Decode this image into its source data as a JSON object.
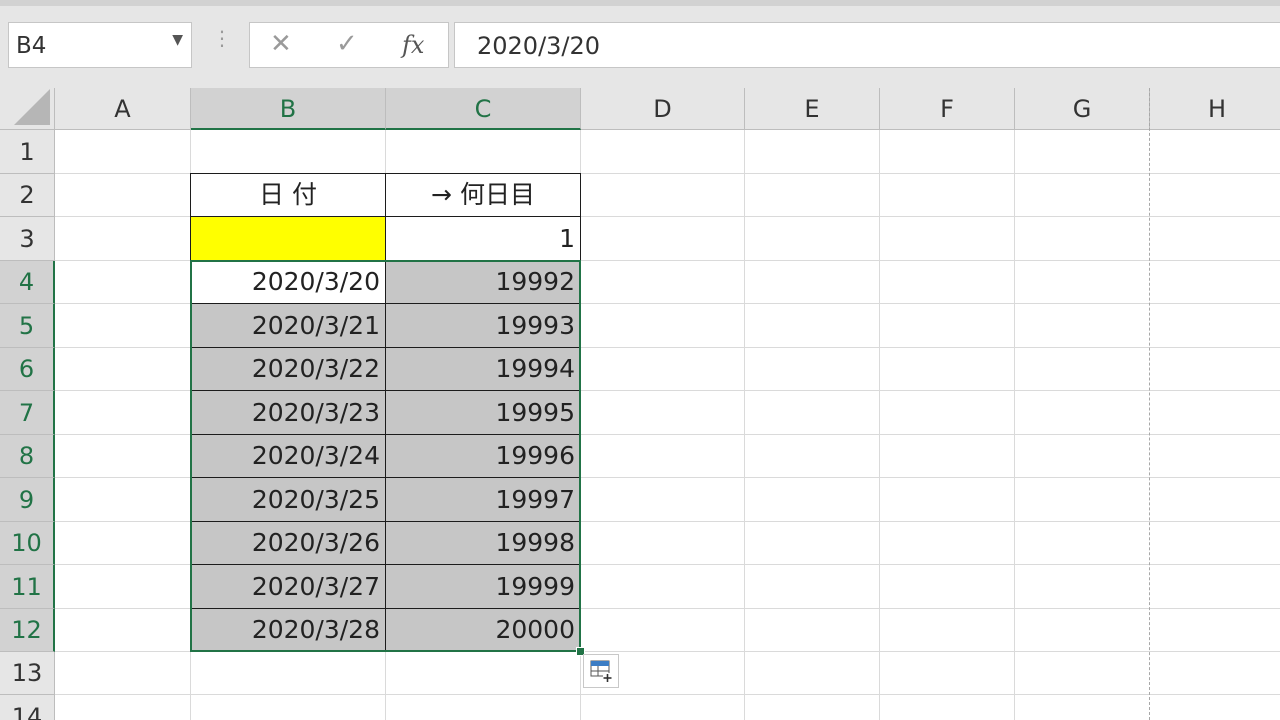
{
  "name_box": {
    "value": "B4",
    "dropdown_icon": "chevron-down-icon"
  },
  "formula_bar": {
    "cancel_icon": "✕",
    "enter_icon": "✓",
    "fx_label": "fx",
    "content": "2020/3/20"
  },
  "columns": [
    "A",
    "B",
    "C",
    "D",
    "E",
    "F",
    "G",
    "H"
  ],
  "rows": [
    "1",
    "2",
    "3",
    "4",
    "5",
    "6",
    "7",
    "8",
    "9",
    "10",
    "11",
    "12",
    "13",
    "14"
  ],
  "selected_columns": [
    "B",
    "C"
  ],
  "selected_rows": [
    "4",
    "5",
    "6",
    "7",
    "8",
    "9",
    "10",
    "11",
    "12"
  ],
  "table": {
    "header": {
      "date": "日 付",
      "nth_day": "→ 何日目"
    },
    "start_value": "1",
    "dates": [
      "2020/3/20",
      "2020/3/21",
      "2020/3/22",
      "2020/3/23",
      "2020/3/24",
      "2020/3/25",
      "2020/3/26",
      "2020/3/27",
      "2020/3/28"
    ],
    "day_numbers": [
      "19992",
      "19993",
      "19994",
      "19995",
      "19996",
      "19997",
      "19998",
      "19999",
      "20000"
    ]
  },
  "colors": {
    "accent": "#217346",
    "selection_fill": "#c6c6c6",
    "highlight": "#ffff00"
  },
  "quick_analysis_icon": "quick-analysis-icon"
}
